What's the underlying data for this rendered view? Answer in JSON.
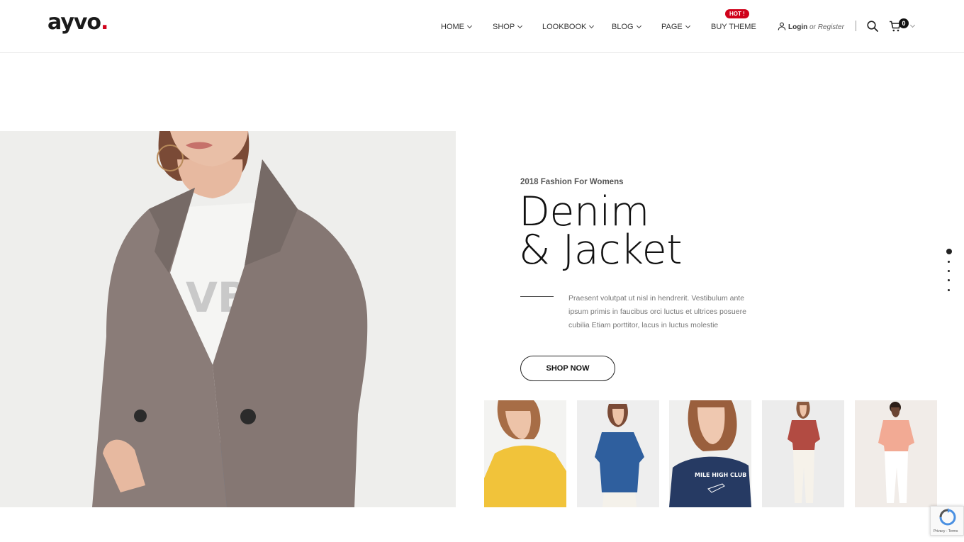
{
  "header": {
    "logo": "ayvo",
    "logo_dot": ".",
    "nav": [
      {
        "label": "HOME"
      },
      {
        "label": "SHOP"
      },
      {
        "label": "LOOKBOOK"
      },
      {
        "label": "BLOG"
      },
      {
        "label": "PAGE"
      },
      {
        "label": "BUY THEME"
      }
    ],
    "hot_badge": "HOT !",
    "login_label": "Login",
    "login_or": "or",
    "register_label": "Register",
    "cart_count": "0"
  },
  "hero": {
    "subtitle": "2018 Fashion For Womens",
    "title_line1": "Denim",
    "title_line2": "& Jacket",
    "description": "Praesent volutpat ut nisl in hendrerit. Vestibulum ante ipsum primis in faucibus orci luctus et ultrices posuere cubilia Etiam porttitor, lacus in luctus molestie",
    "button_label": "SHOP NOW",
    "thumbnail_text": "MILE HIGH CLUB"
  },
  "slider": {
    "dots": 5,
    "active_index": 0
  },
  "recaptcha": {
    "text": "Privacy - Terms"
  },
  "colors": {
    "accent": "#d0021b",
    "text": "#111111",
    "muted": "#777777"
  }
}
